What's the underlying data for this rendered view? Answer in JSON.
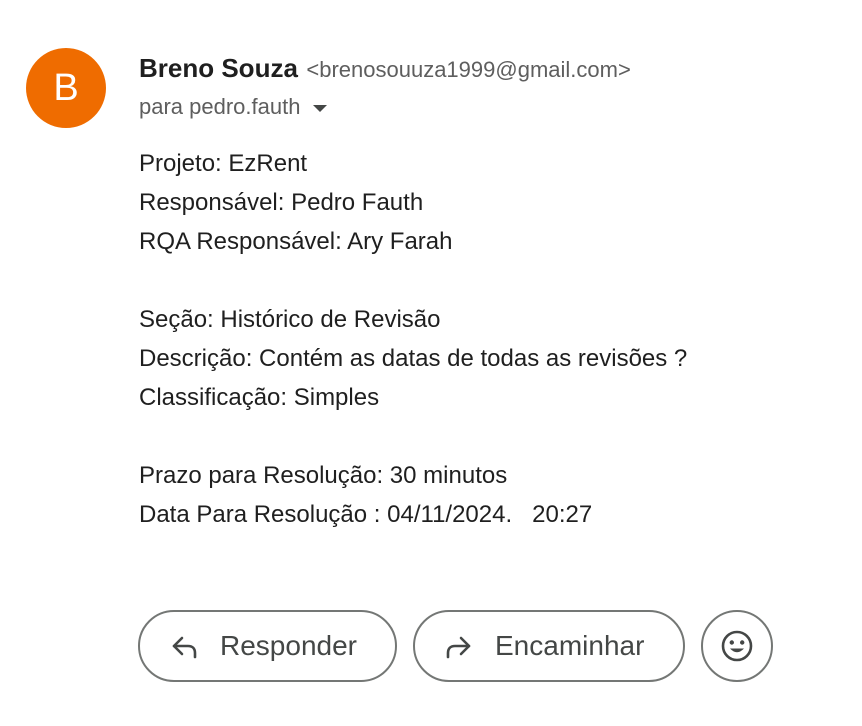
{
  "sender": {
    "avatar_letter": "B",
    "avatar_color": "#ef6c00",
    "name": "Breno Souza",
    "email": "<brenosouuza1999@gmail.com>"
  },
  "recipient": {
    "text": "para pedro.fauth",
    "dropdown_icon": "caret-down-icon"
  },
  "message": {
    "lines": [
      "Projeto: EzRent",
      "Responsável: Pedro Fauth",
      "RQA Responsável: Ary Farah",
      "",
      "Seção: Histórico de Revisão",
      "Descrição: Contém as datas de todas as revisões ?",
      "Classificação: Simples",
      "",
      "Prazo para Resolução: 30 minutos",
      "Data Para Resolução : 04/11/2024.   20:27"
    ]
  },
  "actions": {
    "reply_label": "Responder",
    "reply_icon": "reply-icon",
    "forward_label": "Encaminhar",
    "forward_icon": "forward-icon",
    "emoji_icon": "emoji-smile-icon"
  },
  "colors": {
    "text_primary": "#1f1f1f",
    "text_secondary": "#5e5e5e",
    "button_border": "#747775",
    "button_text": "#444746"
  }
}
